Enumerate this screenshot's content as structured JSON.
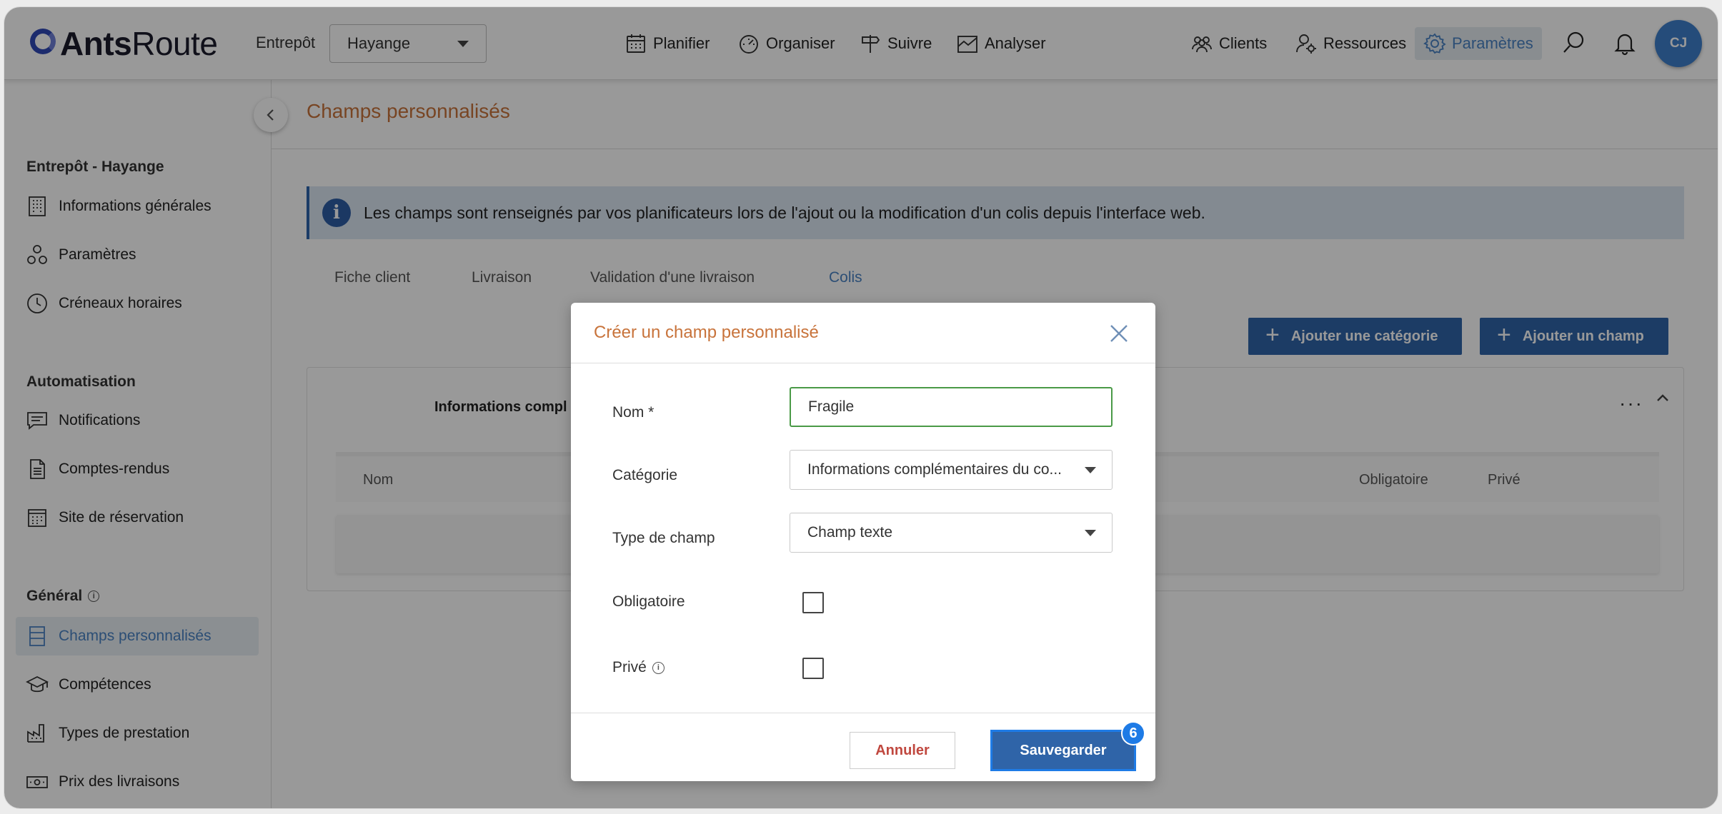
{
  "header": {
    "logo_bold": "Ants",
    "logo_light": "Route",
    "warehouse_label": "Entrepôt",
    "warehouse_value": "Hayange",
    "nav_center": [
      {
        "label": "Planifier",
        "icon": "calendar-icon"
      },
      {
        "label": "Organiser",
        "icon": "gauge-icon"
      },
      {
        "label": "Suivre",
        "icon": "signpost-icon"
      },
      {
        "label": "Analyser",
        "icon": "chart-icon"
      }
    ],
    "nav_right": [
      {
        "label": "Clients",
        "icon": "people-icon"
      },
      {
        "label": "Ressources",
        "icon": "user-gear-icon"
      },
      {
        "label": "Paramètres",
        "icon": "gear-icon",
        "active": true
      }
    ],
    "avatar_initials": "CJ"
  },
  "sidebar": {
    "section_warehouse": "Entrepôt - Hayange",
    "warehouse_items": [
      {
        "label": "Informations générales",
        "icon": "building-icon"
      },
      {
        "label": "Paramètres",
        "icon": "nodes-icon"
      },
      {
        "label": "Créneaux horaires",
        "icon": "clock-icon"
      }
    ],
    "section_automation": "Automatisation",
    "automation_items": [
      {
        "label": "Notifications",
        "icon": "message-icon"
      },
      {
        "label": "Comptes-rendus",
        "icon": "document-icon"
      },
      {
        "label": "Site de réservation",
        "icon": "calendar-grid-icon"
      }
    ],
    "section_general": "Général",
    "general_items": [
      {
        "label": "Champs personnalisés",
        "icon": "list-icon",
        "active": true
      },
      {
        "label": "Compétences",
        "icon": "graduation-icon"
      },
      {
        "label": "Types de prestation",
        "icon": "factory-icon"
      },
      {
        "label": "Prix des livraisons",
        "icon": "banknote-icon"
      }
    ]
  },
  "main": {
    "page_title": "Champs personnalisés",
    "banner_text": "Les champs sont renseignés par vos planificateurs lors de l'ajout ou la modification d'un colis depuis l'interface web.",
    "tabs": [
      {
        "label": "Fiche client"
      },
      {
        "label": "Livraison"
      },
      {
        "label": "Validation d'une livraison"
      },
      {
        "label": "Colis",
        "active": true
      }
    ],
    "add_category_label": "Ajouter une catégorie",
    "add_field_label": "Ajouter un champ",
    "card_title": "Informations compl",
    "table_headers": {
      "name": "Nom",
      "required": "Obligatoire",
      "private": "Privé"
    }
  },
  "modal": {
    "title": "Créer un champ personnalisé",
    "name_label": "Nom *",
    "name_value": "Fragile",
    "category_label": "Catégorie",
    "category_value": "Informations complémentaires du co...",
    "type_label": "Type de champ",
    "type_value": "Champ texte",
    "required_label": "Obligatoire",
    "required_checked": false,
    "private_label": "Privé",
    "private_checked": false,
    "cancel_label": "Annuler",
    "save_label": "Sauvegarder",
    "step_badge": "6"
  },
  "colors": {
    "accent": "#2f64a8",
    "title_orange": "#c8733b",
    "active_blue": "#4a83c4",
    "cancel_red": "#c0483f",
    "input_ok_green": "#4a9a47"
  }
}
